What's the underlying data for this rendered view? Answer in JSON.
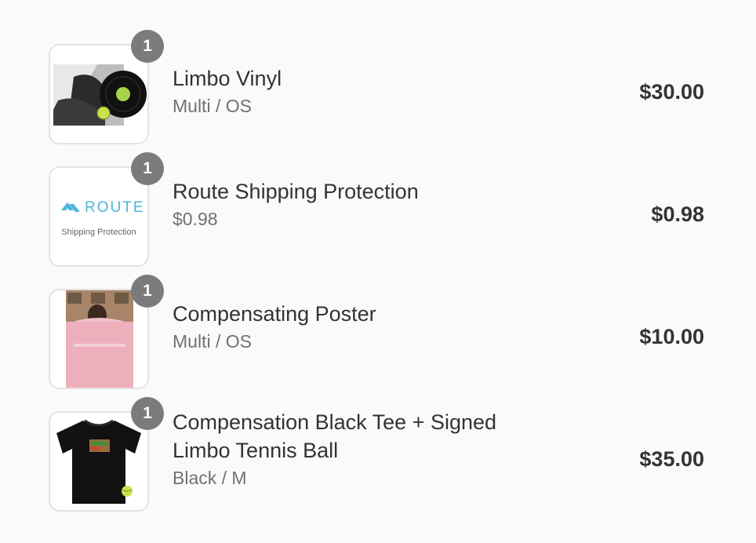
{
  "items": [
    {
      "name": "Limbo Vinyl",
      "variant": "Multi / OS",
      "price": "$30.00",
      "quantity": "1",
      "image": "limbo-vinyl-product-image"
    },
    {
      "name": "Route Shipping Protection",
      "variant": "$0.98",
      "price": "$0.98",
      "quantity": "1",
      "image": "route-shipping-protection-logo",
      "logo_text": "ROUTE",
      "logo_subtext": "Shipping Protection"
    },
    {
      "name": "Compensating Poster",
      "variant": "Multi / OS",
      "price": "$10.00",
      "quantity": "1",
      "image": "compensating-poster-image"
    },
    {
      "name": "Compensation Black Tee + Signed Limbo Tennis Ball",
      "variant": "Black / M",
      "price": "$35.00",
      "quantity": "1",
      "image": "black-tee-product-image"
    }
  ],
  "colors": {
    "background": "#fafafa",
    "badge": "#7b7b7b",
    "text": "#333333",
    "muted": "#717171",
    "route_accent": "#4fb4d8"
  }
}
